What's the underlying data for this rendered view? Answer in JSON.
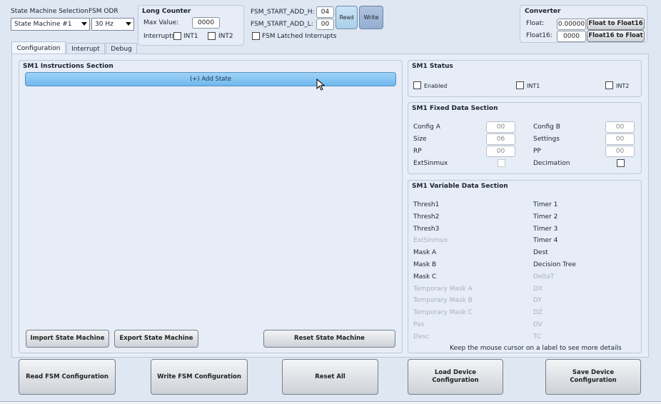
{
  "top": {
    "sm_selection_label": "State Machine Selection",
    "fsm_odr_label": "FSM ODR",
    "sm_select_value": "State Machine #1",
    "odr_select_value": "30 Hz"
  },
  "long_counter": {
    "title": "Long Counter",
    "max_value_label": "Max Value:",
    "max_value": "0000",
    "interrupts_label": "Interrupts",
    "int1": "INT1",
    "int2": "INT2"
  },
  "fsm_start": {
    "addr_h_label": "FSM_START_ADD_H:",
    "addr_h_value": "04",
    "addr_l_label": "FSM_START_ADD_L:",
    "addr_l_value": "00",
    "read_label": "Read",
    "write_label": "Write",
    "latched_label": "FSM Latched Interrupts"
  },
  "converter": {
    "title": "Converter",
    "float_label": "Float:",
    "float_value": "0.00000",
    "float16_label": "Float16:",
    "float16_value": "0000",
    "to_float16_label": "Float to Float16",
    "to_float_label": "Float16 to Float"
  },
  "tabs": [
    "Configuration",
    "Interrupt",
    "Debug"
  ],
  "instructions": {
    "title": "SM1 Instructions Section",
    "add_state_label": "(+) Add State",
    "import_label": "Import State Machine",
    "export_label": "Export State Machine",
    "reset_label": "Reset State Machine"
  },
  "status": {
    "title": "SM1 Status",
    "enabled_label": "Enabled",
    "int1_label": "INT1",
    "int2_label": "INT2"
  },
  "fixed": {
    "title": "SM1 Fixed Data Section",
    "config_a_label": "Config A",
    "config_a_value": "00",
    "size_label": "Size",
    "size_value": "06",
    "rp_label": "RP",
    "rp_value": "00",
    "extsinmux_label": "ExtSinmux",
    "config_b_label": "Config B",
    "config_b_value": "00",
    "settings_label": "Settings",
    "settings_value": "00",
    "pp_label": "PP",
    "pp_value": "00",
    "decimation_label": "Decimation"
  },
  "variable": {
    "title": "SM1 Variable Data Section",
    "left": [
      {
        "label": "Thresh1",
        "enabled": true
      },
      {
        "label": "Thresh2",
        "enabled": true
      },
      {
        "label": "Thresh3",
        "enabled": true
      },
      {
        "label": "ExtSinmux",
        "enabled": false
      },
      {
        "label": "Mask A",
        "enabled": true
      },
      {
        "label": "Mask B",
        "enabled": true
      },
      {
        "label": "Mask C",
        "enabled": true
      },
      {
        "label": "Temporary Mask A",
        "enabled": false
      },
      {
        "label": "Temporary Mask B",
        "enabled": false
      },
      {
        "label": "Temporary Mask C",
        "enabled": false
      },
      {
        "label": "Pas",
        "enabled": false
      },
      {
        "label": "Desc",
        "enabled": false
      }
    ],
    "right": [
      {
        "label": "Timer 1",
        "enabled": true
      },
      {
        "label": "Timer 2",
        "enabled": true
      },
      {
        "label": "Timer 3",
        "enabled": true
      },
      {
        "label": "Timer 4",
        "enabled": true
      },
      {
        "label": "Dest",
        "enabled": true
      },
      {
        "label": "Decision Tree",
        "enabled": true
      },
      {
        "label": "DeltaT",
        "enabled": false
      },
      {
        "label": "DX",
        "enabled": false
      },
      {
        "label": "DY",
        "enabled": false
      },
      {
        "label": "DZ",
        "enabled": false
      },
      {
        "label": "DV",
        "enabled": false
      },
      {
        "label": "TC",
        "enabled": false
      }
    ],
    "hint": "Keep the mouse cursor on a label to see more details"
  },
  "bottom": {
    "read_fsm_label": "Read FSM Configuration",
    "write_fsm_label": "Write FSM Configuration",
    "reset_all_label": "Reset All",
    "load_device_label": "Load Device Configuration",
    "save_device_label": "Save Device Configuration"
  }
}
